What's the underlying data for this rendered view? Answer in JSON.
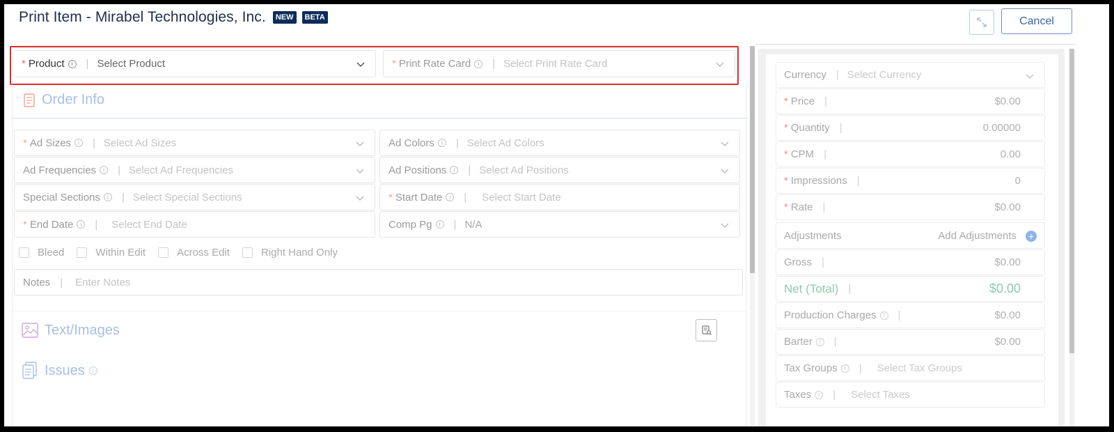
{
  "header": {
    "title": "Print Item - Mirabel Technologies, Inc.",
    "badge_new": "NEW",
    "badge_beta": "BETA",
    "cancel_label": "Cancel",
    "expand_icon": "expand-arrows-icon"
  },
  "top_fields": {
    "product": {
      "label": "Product",
      "placeholder": "Select Product",
      "required": "*"
    },
    "rate_card": {
      "label": "Print Rate Card",
      "placeholder": "Select Print Rate Card",
      "required": "*"
    }
  },
  "order_info": {
    "title": "Order Info",
    "ad_sizes": {
      "label": "Ad Sizes",
      "placeholder": "Select Ad Sizes",
      "required": "*"
    },
    "ad_colors": {
      "label": "Ad Colors",
      "placeholder": "Select Ad Colors"
    },
    "ad_frequencies": {
      "label": "Ad Frequencies",
      "placeholder": "Select Ad Frequencies"
    },
    "ad_positions": {
      "label": "Ad Positions",
      "placeholder": "Select Ad Positions"
    },
    "special_sections": {
      "label": "Special Sections",
      "placeholder": "Select Special Sections"
    },
    "start_date": {
      "label": "Start Date",
      "placeholder": "Select Start Date",
      "required": "*"
    },
    "end_date": {
      "label": "End Date",
      "placeholder": "Select End Date",
      "required": "*"
    },
    "comp_pg": {
      "label": "Comp Pg",
      "value": "N/A"
    },
    "checkboxes": [
      "Bleed",
      "Within Edit",
      "Across Edit",
      "Right Hand Only"
    ],
    "notes": {
      "label": "Notes",
      "placeholder": "Enter Notes"
    }
  },
  "text_images": {
    "title": "Text/Images"
  },
  "issues": {
    "title": "Issues"
  },
  "pricing": {
    "currency": {
      "label": "Currency",
      "placeholder": "Select Currency"
    },
    "price": {
      "label": "Price",
      "value": "$0.00",
      "required": "*"
    },
    "quantity": {
      "label": "Quantity",
      "value": "0.00000",
      "required": "*"
    },
    "cpm": {
      "label": "CPM",
      "value": "0.00",
      "required": "*"
    },
    "impressions": {
      "label": "Impressions",
      "value": "0",
      "required": "*"
    },
    "rate": {
      "label": "Rate",
      "value": "$0.00",
      "required": "*"
    },
    "adjustments": {
      "label": "Adjustments",
      "action": "Add Adjustments"
    },
    "gross": {
      "label": "Gross",
      "value": "$0.00"
    },
    "net": {
      "label": "Net (Total)",
      "value": "$0.00"
    },
    "production": {
      "label": "Production Charges",
      "value": "$0.00"
    },
    "barter": {
      "label": "Barter",
      "value": "$0.00"
    },
    "tax_groups": {
      "label": "Tax Groups",
      "placeholder": "Select Tax Groups"
    },
    "taxes": {
      "label": "Taxes",
      "placeholder": "Select Taxes"
    }
  },
  "colors": {
    "accent": "#3f63a6",
    "required": "#e46a6a",
    "highlight": "#e02b2b",
    "net_green": "#8ecbb0"
  }
}
